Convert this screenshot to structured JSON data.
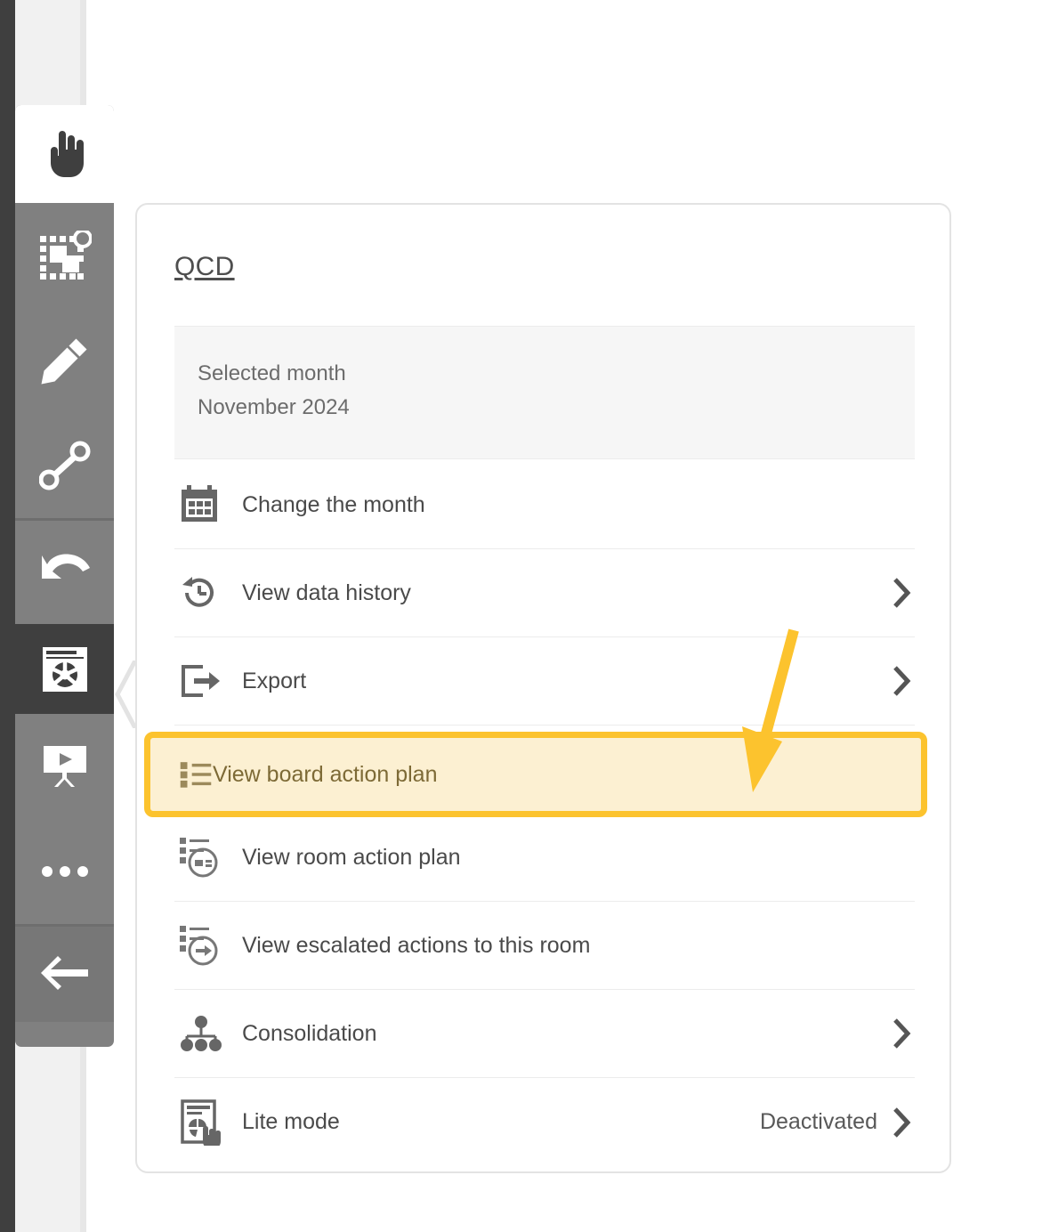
{
  "theme": {
    "panel_bg": "#ffffff",
    "panel_border": "#e3e3e3",
    "toolbar_bg": "#808080",
    "toolbar_active_dark": "#3f3f3f",
    "highlight_border": "#fcc32e",
    "highlight_fill": "#fcf0d2",
    "highlight_text": "#7d6a36",
    "annotation_arrow": "#fcc32e",
    "text_primary": "#4a4a4a",
    "text_secondary": "#6c6c6c",
    "divider": "#ececec",
    "month_box_bg": "#f6f6f6"
  },
  "toolbar": {
    "items": [
      {
        "name": "pointer-hand-tool",
        "icon": "hand-pointer-icon",
        "state": "selected-light",
        "label": "Select"
      },
      {
        "name": "select-shapes-tool",
        "icon": "marquee-select-icon",
        "state": "normal",
        "label": "Marquee select"
      },
      {
        "name": "pen-tool",
        "icon": "pencil-icon",
        "state": "normal",
        "label": "Draw"
      },
      {
        "name": "connector-tool",
        "icon": "link-nodes-icon",
        "state": "normal",
        "label": "Connector"
      },
      {
        "name": "undo-tool",
        "icon": "undo-arrow-icon",
        "state": "normal",
        "label": "Undo"
      },
      {
        "name": "board-settings-tool",
        "icon": "board-lifebuoy-icon",
        "state": "selected-dark",
        "label": "Board menu"
      },
      {
        "name": "presentation-tool",
        "icon": "presentation-icon",
        "state": "normal",
        "label": "Presentation"
      },
      {
        "name": "more-tool",
        "icon": "ellipsis-icon",
        "state": "normal",
        "label": "More"
      },
      {
        "name": "back-tool",
        "icon": "arrow-left-icon",
        "state": "dim",
        "label": "Back"
      }
    ]
  },
  "panel": {
    "title": "QCD",
    "month_box": {
      "label": "Selected month",
      "value": "November 2024"
    },
    "items": [
      {
        "id": "change-the-month",
        "label": "Change the month",
        "icon": "calendar-icon",
        "chevron": false,
        "value": ""
      },
      {
        "id": "view-data-history",
        "label": "View data history",
        "icon": "history-clock-icon",
        "chevron": true,
        "value": ""
      },
      {
        "id": "export",
        "label": "Export",
        "icon": "export-box-arrow-icon",
        "chevron": true,
        "value": ""
      },
      {
        "id": "view-board-action-plan",
        "label": "View board action plan",
        "icon": "list-bullets-icon",
        "chevron": false,
        "value": "",
        "highlighted": true
      },
      {
        "id": "view-room-action-plan",
        "label": "View room action plan",
        "icon": "list-room-circle-icon",
        "chevron": false,
        "value": ""
      },
      {
        "id": "view-escalated-actions",
        "label": "View escalated actions to this room",
        "icon": "list-arrow-circle-icon",
        "chevron": false,
        "value": ""
      },
      {
        "id": "consolidation",
        "label": "Consolidation",
        "icon": "hierarchy-icon",
        "chevron": true,
        "value": ""
      },
      {
        "id": "lite-mode",
        "label": "Lite mode",
        "icon": "lite-mode-tap-icon",
        "chevron": true,
        "value": "Deactivated"
      }
    ]
  },
  "annotation": {
    "type": "arrow",
    "points_to": "view-board-action-plan",
    "color": "#fcc32e"
  }
}
